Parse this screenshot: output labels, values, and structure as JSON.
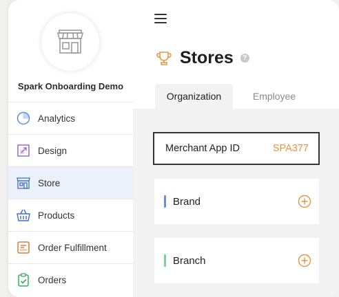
{
  "sidebar": {
    "org_name": "Spark Onboarding Demo",
    "items": [
      {
        "label": "Analytics",
        "icon": "pie-chart-icon",
        "active": false
      },
      {
        "label": "Design",
        "icon": "design-icon",
        "active": false
      },
      {
        "label": "Store",
        "icon": "storefront-icon",
        "active": true
      },
      {
        "label": "Products",
        "icon": "basket-icon",
        "active": false
      },
      {
        "label": "Order Fulfillment",
        "icon": "fulfillment-icon",
        "active": false
      },
      {
        "label": "Orders",
        "icon": "clipboard-check-icon",
        "active": false
      }
    ]
  },
  "header": {
    "title": "Stores",
    "title_icon": "trophy-icon",
    "help_glyph": "?"
  },
  "tabs": [
    {
      "label": "Organization",
      "active": true
    },
    {
      "label": "Employee",
      "active": false
    }
  ],
  "merchant": {
    "label": "Merchant App ID",
    "value": "SPA377"
  },
  "sections": [
    {
      "title": "Brand",
      "accent": "#6a8fd8"
    },
    {
      "title": "Branch",
      "accent": "#7fcf9a"
    }
  ],
  "colors": {
    "accent_orange": "#e8943f",
    "active_nav_bg": "#eaf1fb"
  }
}
